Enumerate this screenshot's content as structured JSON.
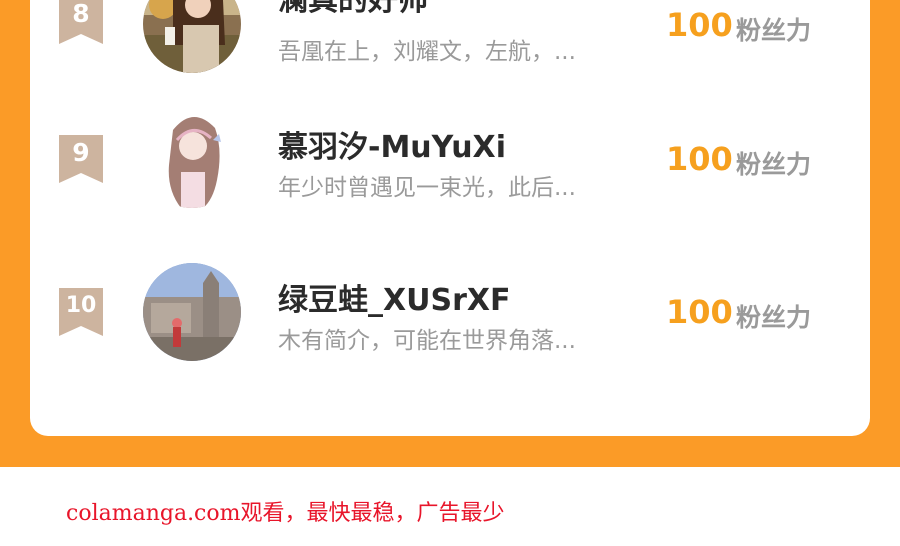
{
  "ranking": {
    "entries": [
      {
        "rank": "8",
        "name": "澜真的好帅",
        "bio": "吾凰在上，刘耀文，左航，...",
        "score": "100",
        "score_label": "粉丝力"
      },
      {
        "rank": "9",
        "name": "慕羽汐-MuYuXi",
        "bio": "年少时曾遇见一束光，此后...",
        "score": "100",
        "score_label": "粉丝力"
      },
      {
        "rank": "10",
        "name": "绿豆蛙_XUSrXF",
        "bio": "木有简介，可能在世界角落...",
        "score": "100",
        "score_label": "粉丝力"
      }
    ]
  },
  "watermark": "colamanga.com观看，最快最稳，广告最少",
  "colors": {
    "frame": "#fb9b27",
    "score": "#f6a01e",
    "badge": "#cdb49f",
    "watermark": "#e8152a"
  }
}
